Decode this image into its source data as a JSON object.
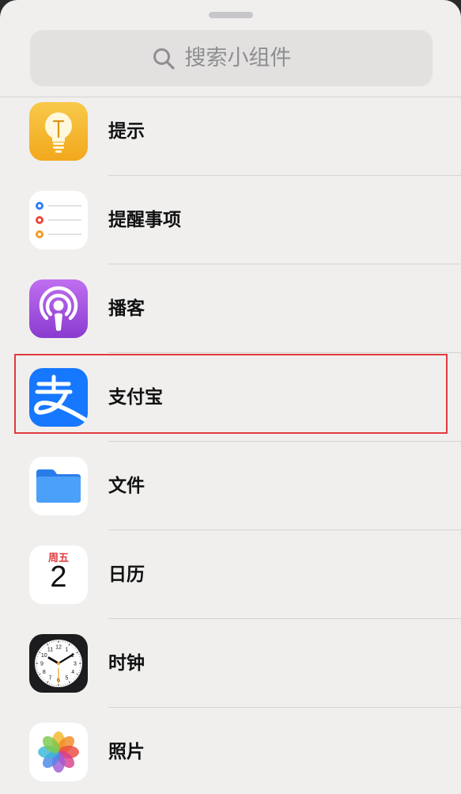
{
  "search": {
    "placeholder": "搜索小组件"
  },
  "items": [
    {
      "label": "提示",
      "icon": "tips-lightbulb-icon"
    },
    {
      "label": "提醒事项",
      "icon": "reminders-icon"
    },
    {
      "label": "播客",
      "icon": "podcasts-icon"
    },
    {
      "label": "支付宝",
      "icon": "alipay-icon"
    },
    {
      "label": "文件",
      "icon": "files-folder-icon"
    },
    {
      "label": "日历",
      "icon": "calendar-icon"
    },
    {
      "label": "时钟",
      "icon": "clock-icon"
    },
    {
      "label": "照片",
      "icon": "photos-icon"
    }
  ],
  "calendar": {
    "weekday": "周五",
    "date": "2"
  },
  "clock_numbers": [
    "12",
    "1",
    "2",
    "3",
    "4",
    "5",
    "6",
    "7",
    "8",
    "9",
    "10",
    "11"
  ],
  "colors": {
    "sheet_bg": "#f0efee",
    "highlight": "#e03a3e",
    "tips_yellow": "#f5b82e",
    "podcasts_purple": "#a04fd8",
    "alipay_blue": "#1677ff",
    "files_blue": "#3a8ef5"
  }
}
